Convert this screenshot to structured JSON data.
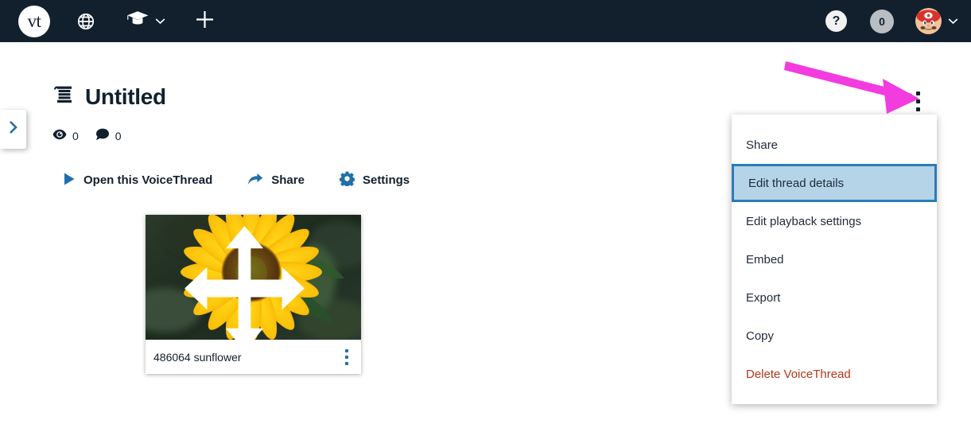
{
  "topbar": {
    "logo_text": "vt",
    "globe_icon": "globe-icon",
    "courses_icon": "graduation-cap-icon",
    "add_icon": "plus-icon",
    "help_label": "?",
    "notification_count": "0",
    "avatar_alt": "user-avatar"
  },
  "left_tab": {
    "icon": "chevron-right-icon"
  },
  "header": {
    "title": "Untitled",
    "thread_icon": "thread-spool-icon",
    "views_count": "0",
    "comments_count": "0"
  },
  "actions": [
    {
      "label": "Open this VoiceThread",
      "icon": "play-icon"
    },
    {
      "label": "Share",
      "icon": "share-arrow-icon"
    },
    {
      "label": "Settings",
      "icon": "gear-icon"
    }
  ],
  "card": {
    "label": "486064 sunflower",
    "move_icon": "move-arrows-icon",
    "menu_icon": "kebab-menu-icon"
  },
  "kebab": {
    "icon": "kebab-menu-icon"
  },
  "menu": {
    "items": [
      {
        "label": "Share",
        "selected": false,
        "danger": false
      },
      {
        "label": "Edit thread details",
        "selected": true,
        "danger": false
      },
      {
        "label": "Edit playback settings",
        "selected": false,
        "danger": false
      },
      {
        "label": "Embed",
        "selected": false,
        "danger": false
      },
      {
        "label": "Export",
        "selected": false,
        "danger": false
      },
      {
        "label": "Copy",
        "selected": false,
        "danger": false
      },
      {
        "label": "Delete VoiceThread",
        "selected": false,
        "danger": true
      }
    ]
  },
  "annotation": {
    "type": "arrow",
    "color": "#f23ce0"
  },
  "colors": {
    "topbar_bg": "#12202e",
    "accent_blue": "#1f6fa9",
    "selected_fill": "#b5d4e8",
    "selected_border": "#2b7cb5",
    "danger_text": "#b0381a",
    "annotation_pink": "#f23ce0"
  }
}
